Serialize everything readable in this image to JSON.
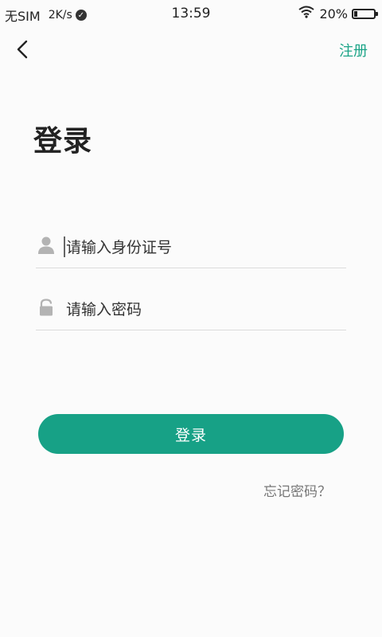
{
  "status_bar": {
    "carrier": "无SIM",
    "speed": "2K/s",
    "time": "13:59",
    "battery": "20%"
  },
  "nav": {
    "register_label": "注册",
    "back_icon": "chevron-left-icon"
  },
  "page": {
    "title": "登录"
  },
  "form": {
    "account": {
      "placeholder": "请输入身份证号",
      "icon": "person-icon"
    },
    "password": {
      "placeholder": "请输入密码",
      "icon": "lock-icon"
    },
    "login_label": "登录",
    "forgot_label": "忘记密码？"
  },
  "colors": {
    "accent": "#17a186",
    "register_text": "#1ba487",
    "icon_gray": "#b3b3b3",
    "divider": "#dcdcdc"
  }
}
